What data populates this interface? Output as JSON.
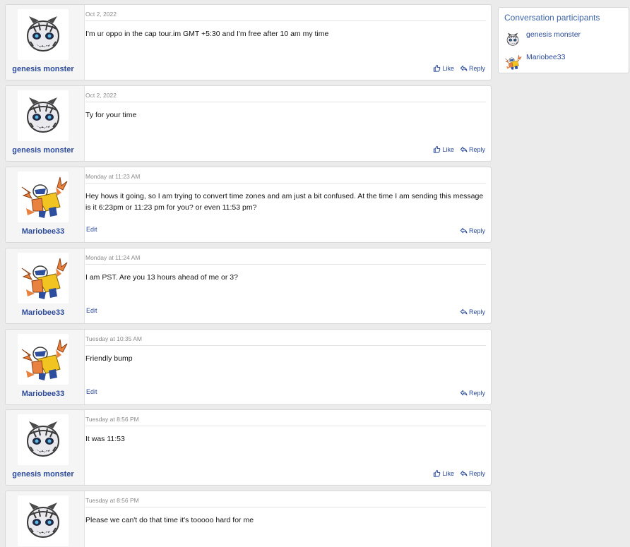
{
  "sidebar": {
    "title": "Conversation participants",
    "participants": [
      {
        "name": "genesis monster",
        "avatar_icon": "glalie-avatar-icon"
      },
      {
        "name": "Mariobee33",
        "avatar_icon": "hawlucha-avatar-icon"
      }
    ]
  },
  "actions": {
    "like": "Like",
    "reply": "Reply",
    "edit": "Edit"
  },
  "messages": [
    {
      "user": "genesis monster",
      "date": "Oct 2, 2022",
      "text": "I'm ur oppo in the cap tour.im GMT +5:30 and I'm free after 10 am my time"
    },
    {
      "user": "genesis monster",
      "date": "Oct 2, 2022",
      "text": "Ty for your time"
    },
    {
      "user": "Mariobee33",
      "date": "Monday at 11:23 AM",
      "text": "Hey hows it going, so I am trying to convert time zones and am just a bit confused. At the time I am sending this message is it 6:23pm or 11:23 pm for you? or even 11:53 pm?"
    },
    {
      "user": "Mariobee33",
      "date": "Monday at 11:24 AM",
      "text": "I am PST. Are you 13 hours ahead of me or 3?"
    },
    {
      "user": "Mariobee33",
      "date": "Tuesday at 10:35 AM",
      "text": "Friendly bump"
    },
    {
      "user": "genesis monster",
      "date": "Tuesday at 8:56 PM",
      "text": "It was 11:53"
    },
    {
      "user": "genesis monster",
      "date": "Tuesday at 8:56 PM",
      "text": "Please we can't do that time it's tooooo hard for me"
    }
  ],
  "colors": {
    "link": "#2c4b9a",
    "sidebar_title": "#3f66a7",
    "page_bg": "#ebebeb"
  }
}
